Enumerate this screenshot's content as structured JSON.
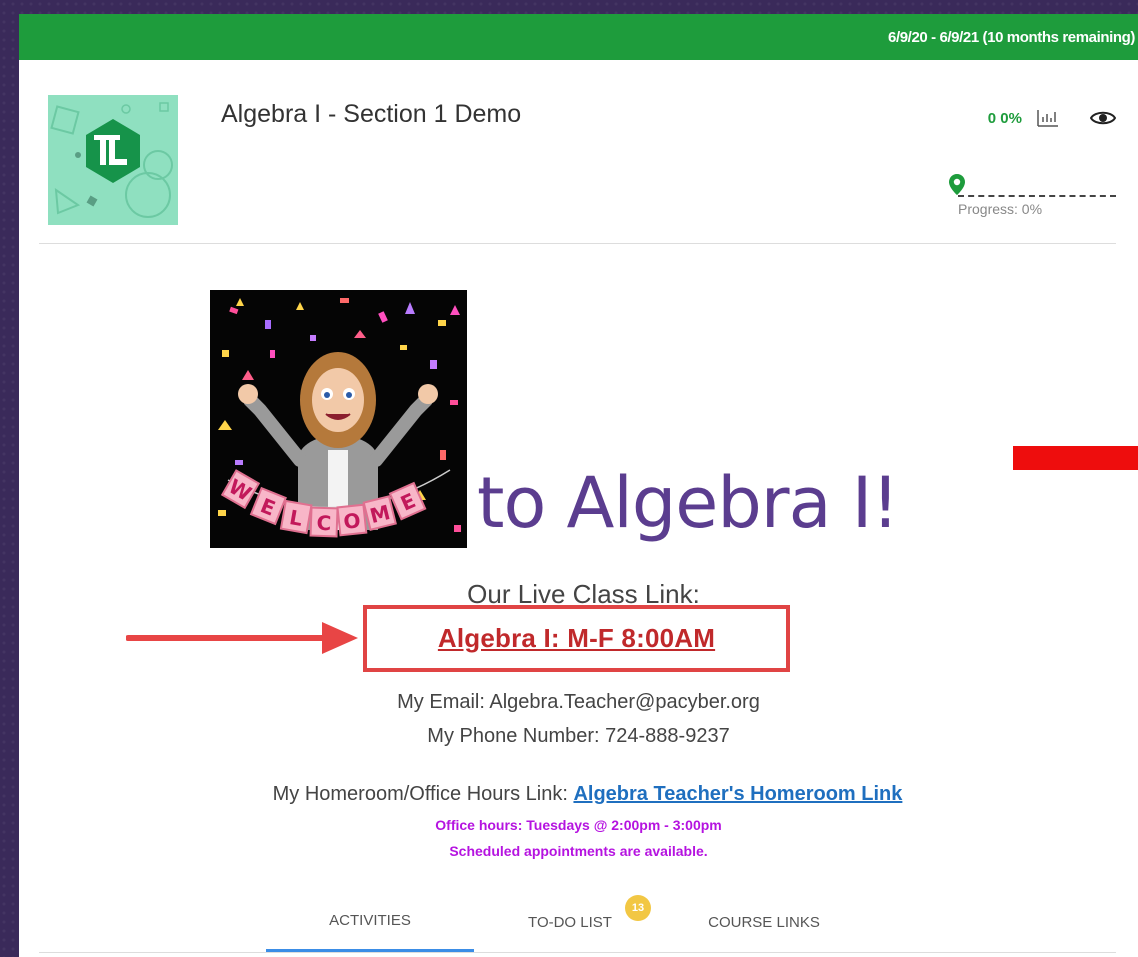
{
  "header": {
    "date_range": "6/9/20 - 6/9/21 (10 months remaining)"
  },
  "course": {
    "title": "Algebra I - Section 1 Demo",
    "grade": "0 0%",
    "progress_label": "Progress: 0%",
    "progress_value": 0,
    "icons": {
      "stats": "bar-chart-icon",
      "view": "eye-icon",
      "location": "map-pin-icon"
    }
  },
  "welcome": {
    "banner_text": "WELCOME",
    "heading_text": "to Algebra I!"
  },
  "live_class": {
    "heading": "Our Live Class Link:",
    "link_label": "Algebra I: M-F 8:00AM"
  },
  "contact": {
    "email_line": "My Email:  Algebra.Teacher@pacyber.org",
    "phone_line": "My Phone Number:  724-888-9237"
  },
  "homeroom": {
    "label": "My Homeroom/Office Hours Link:  ",
    "link_label": "Algebra Teacher's Homeroom Link",
    "office_hours": "Office hours:  Tuesdays @  2:00pm - 3:00pm",
    "appointments": "Scheduled appointments are available."
  },
  "tabs": {
    "activities": "ACTIVITIES",
    "todo": "TO-DO LIST",
    "todo_badge": "13",
    "links": "COURSE LINKS"
  },
  "colors": {
    "green": "#1e9c3c",
    "purple_text": "#5b3d8f",
    "link_red": "#c0292b",
    "link_blue": "#1f6fbf",
    "office_magenta": "#b513e0",
    "highlight_red": "#e04444"
  }
}
